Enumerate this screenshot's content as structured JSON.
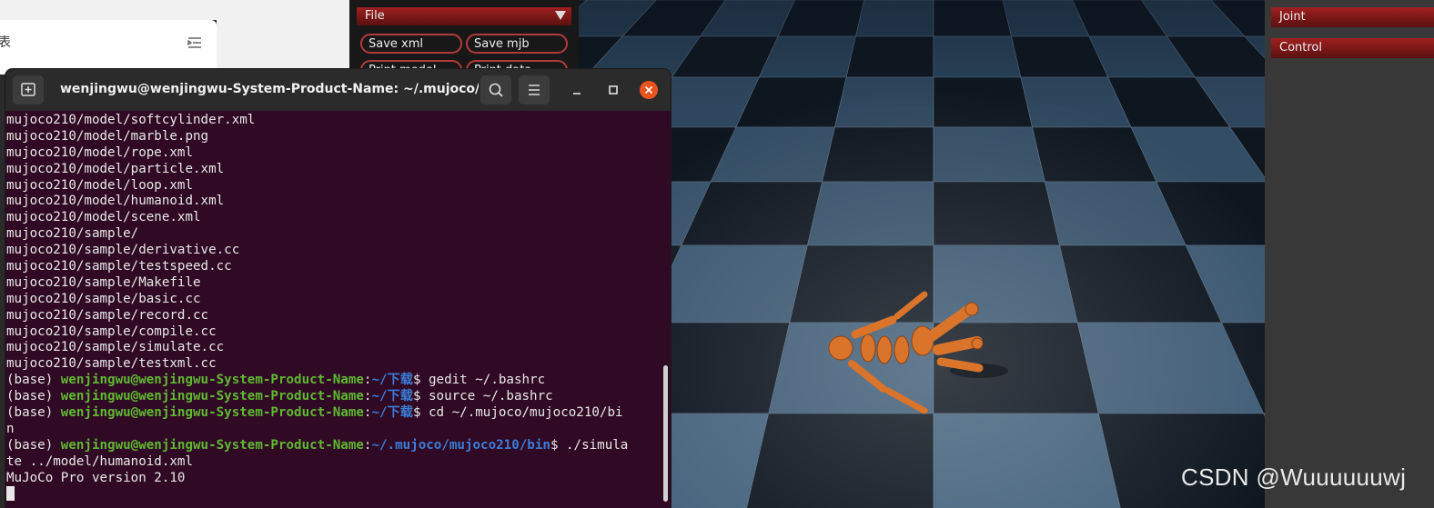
{
  "background_doc": {
    "partial_glyph": "表"
  },
  "mujoco_left": {
    "section_title": "File",
    "buttons": [
      "Save xml",
      "Save mjb",
      "Print model",
      "Print data"
    ]
  },
  "mujoco_right": {
    "sections": [
      "Joint",
      "Control"
    ]
  },
  "terminal": {
    "title": "wenjingwu@wenjingwu-System-Product-Name: ~/.mujoco/mu...",
    "file_lines": [
      "mujoco210/model/softcylinder.xml",
      "mujoco210/model/marble.png",
      "mujoco210/model/rope.xml",
      "mujoco210/model/particle.xml",
      "mujoco210/model/loop.xml",
      "mujoco210/model/humanoid.xml",
      "mujoco210/model/scene.xml",
      "mujoco210/sample/",
      "mujoco210/sample/derivative.cc",
      "mujoco210/sample/testspeed.cc",
      "mujoco210/sample/Makefile",
      "mujoco210/sample/basic.cc",
      "mujoco210/sample/record.cc",
      "mujoco210/sample/compile.cc",
      "mujoco210/sample/simulate.cc",
      "mujoco210/sample/testxml.cc"
    ],
    "prompts": [
      {
        "env": "(base) ",
        "userhost": "wenjingwu@wenjingwu-System-Product-Name",
        "path": "~/下载",
        "cmd": "$ gedit ~/.bashrc"
      },
      {
        "env": "(base) ",
        "userhost": "wenjingwu@wenjingwu-System-Product-Name",
        "path": "~/下载",
        "cmd": "$ source ~/.bashrc"
      },
      {
        "env": "(base) ",
        "userhost": "wenjingwu@wenjingwu-System-Product-Name",
        "path": "~/下载",
        "cmd": "$ cd ~/.mujoco/mujoco210/bi",
        "wrap": "n"
      },
      {
        "env": "(base) ",
        "userhost": "wenjingwu@wenjingwu-System-Product-Name",
        "path": "~/.mujoco/mujoco210/bin",
        "cmd": "$ ./simula",
        "wrap": "te ../model/humanoid.xml"
      }
    ],
    "output_line": "MuJoCo Pro version 2.10"
  },
  "watermark": "CSDN @Wuuuuuuwj",
  "colors": {
    "terminal_bg": "#300a24",
    "prompt_green": "#5fb832",
    "prompt_blue": "#3b7dd8",
    "close_orange": "#e95420",
    "mujoco_red": "#a02020",
    "humanoid": "#d9742a"
  }
}
